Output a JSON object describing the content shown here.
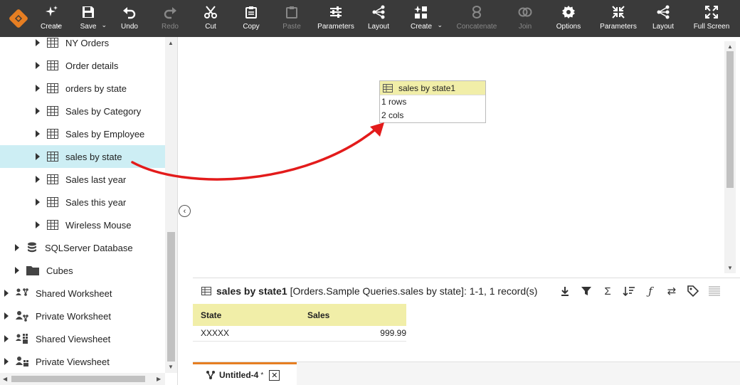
{
  "toolbar": {
    "buttons": [
      {
        "label": "Create",
        "icon": "sparkle-icon",
        "caret": true,
        "disabled": false
      },
      {
        "label": "Save",
        "icon": "save-icon",
        "caret": true,
        "disabled": false
      },
      {
        "label": "Undo",
        "icon": "undo-icon",
        "caret": false,
        "disabled": false
      },
      {
        "label": "Redo",
        "icon": "redo-icon",
        "caret": false,
        "disabled": true
      },
      {
        "label": "Cut",
        "icon": "scissors-icon",
        "caret": false,
        "disabled": false
      },
      {
        "label": "Copy",
        "icon": "copy-icon",
        "caret": false,
        "disabled": false
      },
      {
        "label": "Paste",
        "icon": "paste-icon",
        "caret": false,
        "disabled": true
      },
      {
        "label": "Parameters",
        "icon": "sliders-icon",
        "caret": false,
        "disabled": false
      },
      {
        "label": "Layout",
        "icon": "layout-icon",
        "caret": false,
        "disabled": false
      },
      {
        "label": "Create",
        "icon": "shapes-icon",
        "caret": true,
        "disabled": false
      },
      {
        "label": "Concatenate",
        "icon": "concatenate-icon",
        "caret": false,
        "disabled": true
      },
      {
        "label": "Join",
        "icon": "join-icon",
        "caret": false,
        "disabled": true
      },
      {
        "label": "Options",
        "icon": "gear-icon",
        "caret": false,
        "disabled": false
      },
      {
        "label": "Parameters",
        "icon": "compress-icon",
        "caret": false,
        "disabled": false
      },
      {
        "label": "Layout",
        "icon": "layout-icon",
        "caret": false,
        "disabled": false
      },
      {
        "label": "Full Screen",
        "icon": "expand-icon",
        "caret": false,
        "disabled": false
      }
    ]
  },
  "tree": {
    "items": [
      {
        "label": "NY Orders",
        "icon": "table-icon",
        "selected": false
      },
      {
        "label": "Order details",
        "icon": "table-icon",
        "selected": false
      },
      {
        "label": "orders by state",
        "icon": "table-icon",
        "selected": false
      },
      {
        "label": "Sales by Category",
        "icon": "table-icon",
        "selected": false
      },
      {
        "label": "Sales by Employee",
        "icon": "table-icon",
        "selected": false
      },
      {
        "label": "sales by state",
        "icon": "table-icon",
        "selected": true
      },
      {
        "label": "Sales last year",
        "icon": "table-icon",
        "selected": false
      },
      {
        "label": "Sales this year",
        "icon": "table-icon",
        "selected": false
      },
      {
        "label": "Wireless Mouse",
        "icon": "table-icon",
        "selected": false
      },
      {
        "label": "SQLServer Database",
        "icon": "database-icon",
        "selected": false
      },
      {
        "label": "Cubes",
        "icon": "folder-icon",
        "selected": false
      },
      {
        "label": "Shared Worksheet",
        "icon": "shared-worksheet-icon",
        "selected": false
      },
      {
        "label": "Private Worksheet",
        "icon": "private-worksheet-icon",
        "selected": false
      },
      {
        "label": "Shared Viewsheet",
        "icon": "shared-viewsheet-icon",
        "selected": false
      },
      {
        "label": "Private Viewsheet",
        "icon": "private-viewsheet-icon",
        "selected": false
      }
    ]
  },
  "node": {
    "title": "sales by state1",
    "rows": "1 rows",
    "cols": "2 cols"
  },
  "data_pane": {
    "name": "sales by state1",
    "detail": "[Orders.Sample Queries.sales by state]: 1-1, 1 record(s)",
    "columns": [
      "State",
      "Sales"
    ],
    "rows": [
      [
        "XXXXX",
        "999.99"
      ]
    ]
  },
  "tab": {
    "title": "Untitled-4",
    "modified_marker": "*"
  },
  "colors": {
    "toolbar_bg": "#3a3a3a",
    "accent": "#e67e22",
    "selected_row": "#cdeef4",
    "header_yellow": "#f1eea8",
    "arrow": "#e31b1b"
  }
}
